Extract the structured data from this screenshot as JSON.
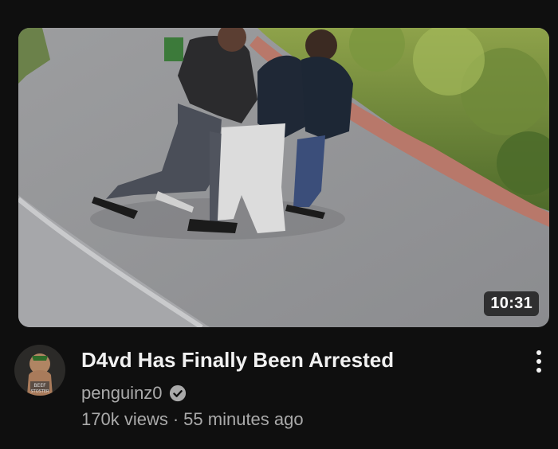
{
  "video": {
    "title": "D4vd Has Finally Been Arrested",
    "duration": "10:31",
    "channel": "penguinz0",
    "verified_icon": "verified-check-icon",
    "views": "170k views",
    "separator": "·",
    "age": "55 minutes ago",
    "avatar_text": "BEEF\nSTOSTER"
  },
  "menu": {
    "icon": "more-vertical-icon"
  },
  "colors": {
    "background": "#0f0f0f",
    "title": "#f1f1f1",
    "secondary_text": "#aaaaaa"
  }
}
